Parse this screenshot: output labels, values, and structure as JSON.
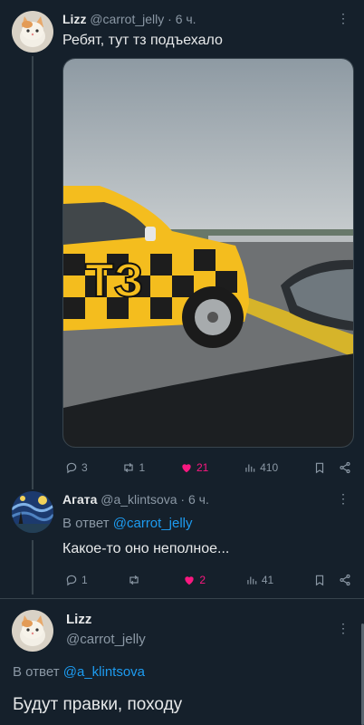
{
  "post1": {
    "name": "Lizz",
    "handle": "@carrot_jelly",
    "time": "· 6 ч.",
    "text": "Ребят, тут тз подъехало",
    "more": "⋮",
    "stats": {
      "replies": "3",
      "reposts": "1",
      "likes": "21",
      "views": "410"
    }
  },
  "post2": {
    "name": "Агата",
    "handle": "@a_klintsova",
    "time": "· 6 ч.",
    "reply_prefix": "В ответ",
    "reply_to": "@carrot_jelly",
    "text": "Какое-то оно неполное...",
    "more": "⋮",
    "stats": {
      "replies": "1",
      "reposts": "",
      "likes": "2",
      "views": "41"
    }
  },
  "post3": {
    "name": "Lizz",
    "handle": "@carrot_jelly",
    "reply_prefix": "В ответ",
    "reply_to": "@a_klintsova",
    "text": "Будут правки, походу",
    "more": "⋮"
  },
  "media": {
    "car_label": "ТЗ"
  },
  "colors": {
    "background": "#15202b",
    "accent": "#1d9bf0",
    "like": "#f91880",
    "muted": "#8b98a5"
  }
}
